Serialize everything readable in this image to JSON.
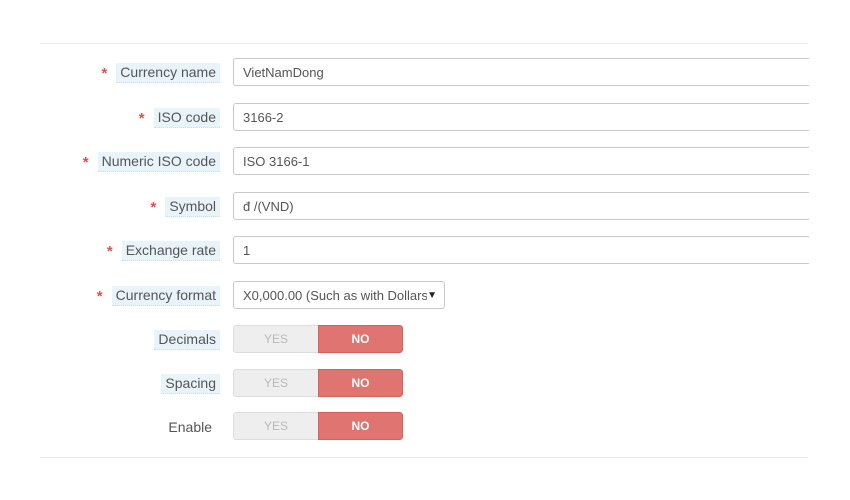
{
  "form": {
    "required_marker": "*",
    "currency_name": {
      "label": "Currency name",
      "value": "VietNamDong"
    },
    "iso_code": {
      "label": "ISO code",
      "value": "3166-2"
    },
    "numeric_iso_code": {
      "label": "Numeric ISO code",
      "value": "ISO 3166-1"
    },
    "symbol": {
      "label": "Symbol",
      "value": "đ /(VND)"
    },
    "exchange_rate": {
      "label": "Exchange rate",
      "value": "1"
    },
    "currency_format": {
      "label": "Currency format",
      "selected": "X0,000.00 (Such as with Dollars)"
    },
    "decimals": {
      "label": "Decimals",
      "yes_label": "YES",
      "no_label": "NO",
      "selected": "NO"
    },
    "spacing": {
      "label": "Spacing",
      "yes_label": "YES",
      "no_label": "NO",
      "selected": "NO"
    },
    "enable": {
      "label": "Enable",
      "yes_label": "YES",
      "no_label": "NO",
      "selected": "NO"
    }
  },
  "colors": {
    "required": "#e0504f",
    "toggle_selected": "#e07470",
    "label_hint_bg": "#e9f4fa"
  },
  "icons": {
    "select_caret": "caret-down-icon"
  }
}
